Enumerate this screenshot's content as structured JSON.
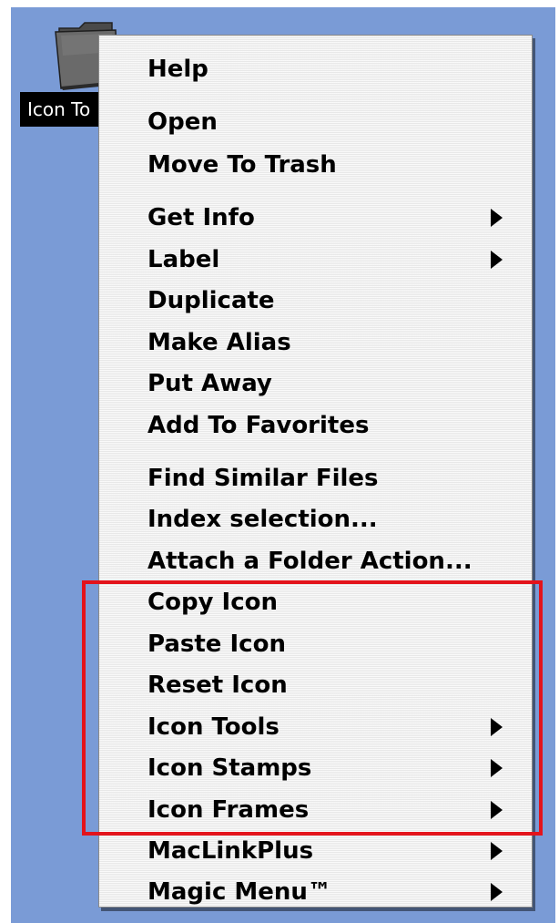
{
  "desktop": {
    "background_color": "#7a9bd6",
    "selected_icon": {
      "icon": "folder-icon",
      "label": "Icon To"
    }
  },
  "context_menu": {
    "items": [
      {
        "label": "Help",
        "submenu": false
      },
      {
        "label": "Open",
        "submenu": false
      },
      {
        "label": "Move To Trash",
        "submenu": false
      },
      {
        "label": "Get Info",
        "submenu": true
      },
      {
        "label": "Label",
        "submenu": true
      },
      {
        "label": "Duplicate",
        "submenu": false
      },
      {
        "label": "Make Alias",
        "submenu": false
      },
      {
        "label": "Put Away",
        "submenu": false
      },
      {
        "label": "Add To Favorites",
        "submenu": false
      },
      {
        "label": "Find Similar Files",
        "submenu": false
      },
      {
        "label": "Index selection...",
        "submenu": false
      },
      {
        "label": "Attach a Folder Action...",
        "submenu": false
      },
      {
        "label": "Copy Icon",
        "submenu": false
      },
      {
        "label": "Paste Icon",
        "submenu": false
      },
      {
        "label": "Reset Icon",
        "submenu": false
      },
      {
        "label": "Icon Tools",
        "submenu": true
      },
      {
        "label": "Icon Stamps",
        "submenu": true
      },
      {
        "label": "Icon Frames",
        "submenu": true
      },
      {
        "label": "MacLinkPlus",
        "submenu": true
      },
      {
        "label": "Magic Menu™",
        "submenu": true
      }
    ],
    "highlight": {
      "color": "#e3131b",
      "items": [
        "Copy Icon",
        "Paste Icon",
        "Reset Icon",
        "Icon Tools",
        "Icon Stamps",
        "Icon Frames"
      ]
    }
  }
}
